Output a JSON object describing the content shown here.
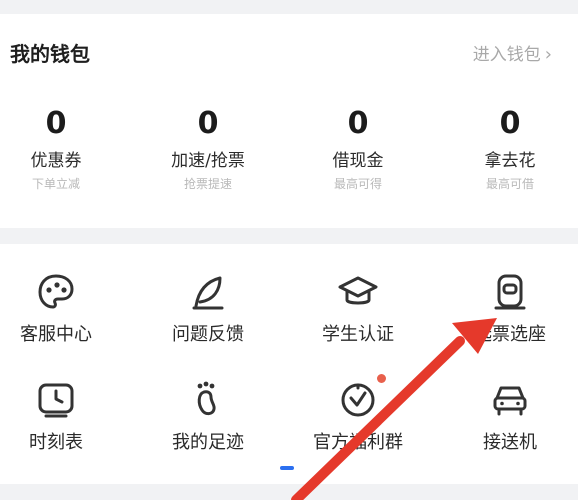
{
  "wallet": {
    "title": "我的钱包",
    "link": "进入钱包",
    "link_chevron": "chevron-right-icon",
    "items": [
      {
        "value": "0",
        "label": "优惠券",
        "sub": "下单立减"
      },
      {
        "value": "0",
        "label": "加速/抢票",
        "sub": "抢票提速"
      },
      {
        "value": "0",
        "label": "借现金",
        "sub": "最高可得"
      },
      {
        "value": "0",
        "label": "拿去花",
        "sub": "最高可借"
      }
    ]
  },
  "services": {
    "items": [
      {
        "label": "客服中心",
        "icon": "customer-service-icon"
      },
      {
        "label": "问题反馈",
        "icon": "feedback-icon"
      },
      {
        "label": "学生认证",
        "icon": "graduation-cap-icon"
      },
      {
        "label": "选票选座",
        "icon": "seat-icon"
      },
      {
        "label": "时刻表",
        "icon": "clock-icon"
      },
      {
        "label": "我的足迹",
        "icon": "footprint-icon"
      },
      {
        "label": "官方福利群",
        "icon": "timer-icon",
        "badge": true
      },
      {
        "label": "接送机",
        "icon": "car-icon"
      }
    ]
  },
  "colors": {
    "accent": "#2b6ff0",
    "badge": "#e8604c",
    "annotation_arrow": "#e5392b"
  }
}
